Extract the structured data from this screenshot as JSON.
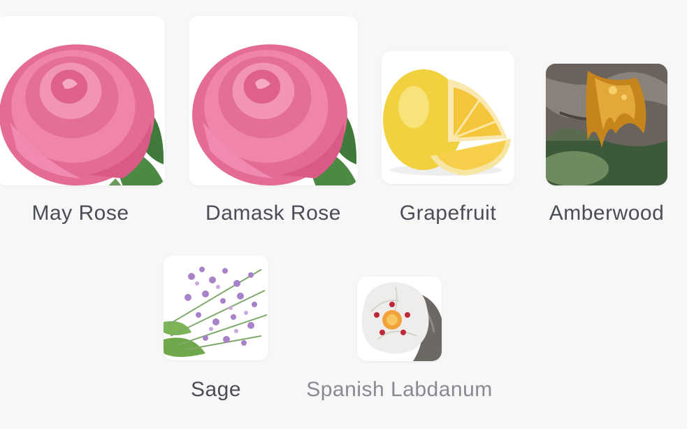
{
  "notes": [
    {
      "label": "May Rose",
      "icon": "may-rose-icon"
    },
    {
      "label": "Damask Rose",
      "icon": "damask-rose-icon"
    },
    {
      "label": "Grapefruit",
      "icon": "grapefruit-icon"
    },
    {
      "label": "Amberwood",
      "icon": "amberwood-icon"
    },
    {
      "label": "Sage",
      "icon": "sage-icon"
    },
    {
      "label": "Spanish Labdanum",
      "icon": "labdanum-icon"
    }
  ],
  "colors": {
    "background": "#f7f7f8",
    "tile": "#ffffff",
    "label": "#4a4d55",
    "label_muted": "#878a91",
    "rose": "#e9739b",
    "grapefruit": "#f3d44a",
    "amber": "#c8871c",
    "sage_flower": "#a882c8"
  }
}
